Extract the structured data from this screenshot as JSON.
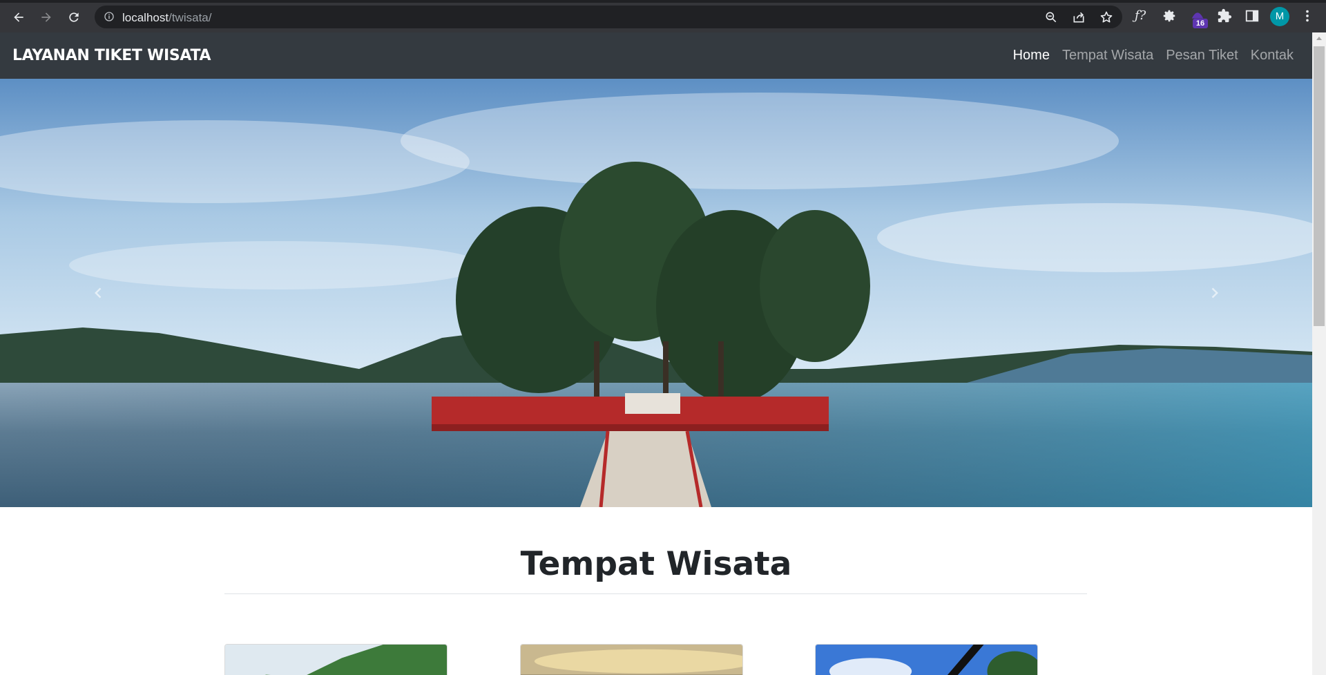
{
  "browser": {
    "url_host": "localhost",
    "url_path": "/twisata/",
    "extension_badge": "16",
    "profile_initial": "M",
    "icons": [
      "back-icon",
      "forward-icon",
      "reload-icon",
      "info-icon",
      "zoom-icon",
      "share-icon",
      "star-icon",
      "function-icon",
      "gear-icon",
      "extension-icon",
      "puzzle-icon",
      "sidepanel-icon",
      "more-icon"
    ]
  },
  "navbar": {
    "brand": "LAYANAN TIKET WISATA",
    "links": [
      {
        "label": "Home",
        "active": true
      },
      {
        "label": "Tempat Wisata",
        "active": false
      },
      {
        "label": "Pesan Tiket",
        "active": false
      },
      {
        "label": "Kontak",
        "active": false
      }
    ]
  },
  "carousel": {
    "controls": [
      "chevron-left-icon",
      "chevron-right-icon"
    ]
  },
  "section": {
    "title": "Tempat Wisata"
  },
  "colors": {
    "navbar_bg": "#343a40",
    "chrome_bg": "#35363a",
    "omnibox_bg": "#202124",
    "avatar_bg": "#0097a7",
    "badge_bg": "#5e35b1"
  }
}
